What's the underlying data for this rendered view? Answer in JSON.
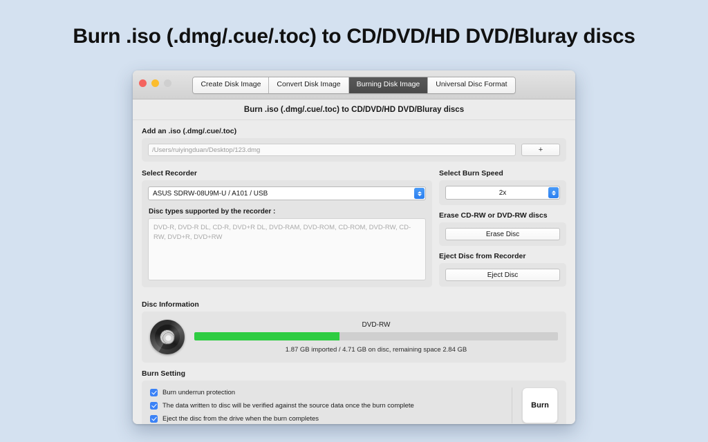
{
  "headline": "Burn .iso (.dmg/.cue/.toc) to CD/DVD/HD DVD/Bluray discs",
  "window": {
    "traffic_lights": [
      "close",
      "minimize",
      "zoom"
    ],
    "tabs": [
      {
        "label": "Create Disk Image",
        "active": false
      },
      {
        "label": "Convert Disk Image",
        "active": false
      },
      {
        "label": "Burning Disk Image",
        "active": true
      },
      {
        "label": "Universal Disc Format",
        "active": false
      }
    ],
    "subtitle": "Burn .iso (.dmg/.cue/.toc) to CD/DVD/HD DVD/Bluray discs"
  },
  "add_iso": {
    "label": "Add an .iso (.dmg/.cue/.toc)",
    "path_value": "/Users/ruiyingduan/Desktop/123.dmg",
    "add_button_label": "+"
  },
  "recorder": {
    "label": "Select Recorder",
    "selected": "ASUS SDRW-08U9M-U / A101 / USB",
    "types_label": "Disc types supported by the recorder :",
    "types_value": "DVD-R, DVD-R DL, CD-R, DVD+R DL, DVD-RAM, DVD-ROM, CD-ROM, DVD-RW, CD-RW, DVD+R, DVD+RW"
  },
  "burn_speed": {
    "label": "Select Burn Speed",
    "selected": "2x"
  },
  "erase": {
    "label": "Erase CD-RW or DVD-RW discs",
    "button_label": "Erase Disc"
  },
  "eject": {
    "label": "Eject Disc from Recorder",
    "button_label": "Eject Disc"
  },
  "disc_information": {
    "label": "Disc Information",
    "disc_type": "DVD-RW",
    "progress_percent": 40,
    "stats": "1.87 GB imported / 4.71 GB on disc, remaining space 2.84 GB"
  },
  "burn_setting": {
    "label": "Burn Setting",
    "options": [
      {
        "label": "Burn underrun protection",
        "checked": true
      },
      {
        "label": "The data written to disc will be verified against the source data once the burn complete",
        "checked": true
      },
      {
        "label": "Eject the disc from the drive when the burn completes",
        "checked": true
      }
    ],
    "burn_button_label": "Burn"
  },
  "colors": {
    "page_background": "#d4e1f0",
    "window_background": "#ececec",
    "panel_background": "#e4e4e4",
    "accent_blue": "#3b82f6",
    "progress_green": "#2ecc41",
    "active_tab": "#4f4f4f"
  }
}
